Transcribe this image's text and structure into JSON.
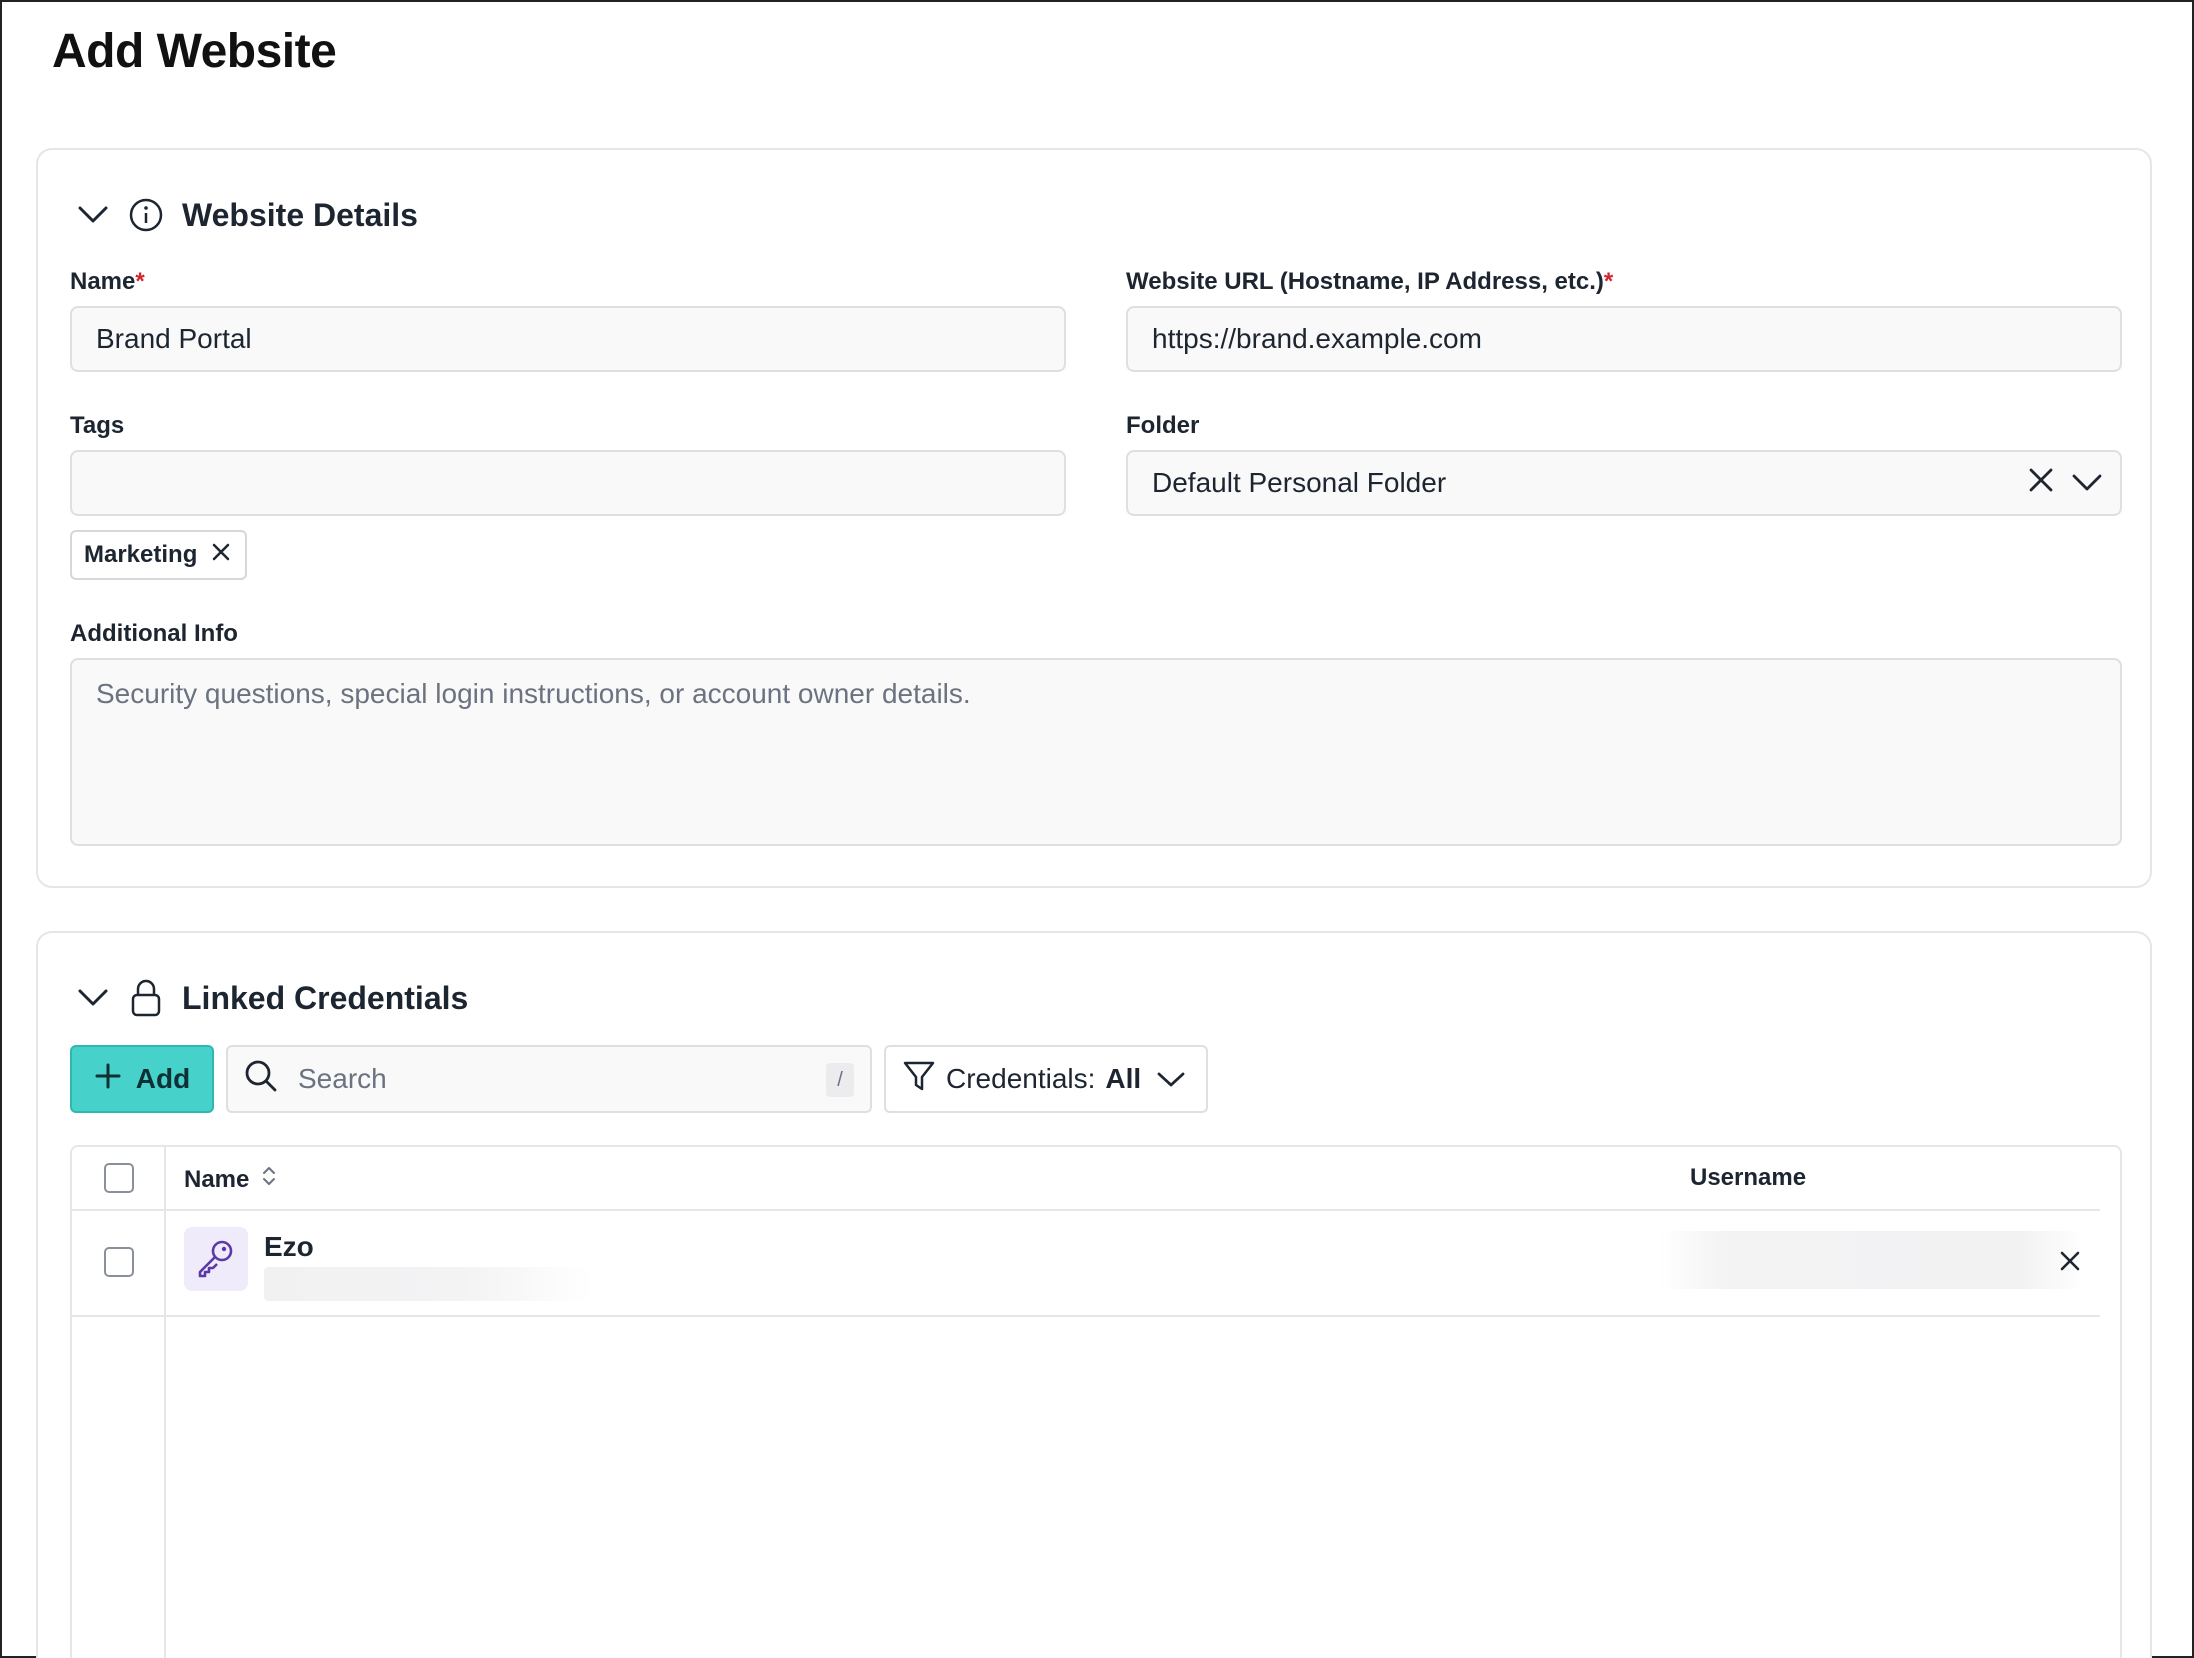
{
  "page": {
    "title": "Add Website"
  },
  "details": {
    "title": "Website Details",
    "name_label": "Name",
    "name_value": "Brand Portal",
    "url_label": "Website URL (Hostname, IP Address, etc.)",
    "url_value": "https://brand.example.com",
    "required_mark": "*",
    "tags_label": "Tags",
    "tags_value": "",
    "tags": [
      "Marketing"
    ],
    "folder_label": "Folder",
    "folder_value": "Default Personal Folder",
    "info_label": "Additional Info",
    "info_placeholder": "Security questions, special login instructions, or account owner details."
  },
  "credentials": {
    "title": "Linked Credentials",
    "add_label": "Add",
    "search_placeholder": "Search",
    "search_shortcut": "/",
    "filter_prefix": "Credentials:",
    "filter_value": "All",
    "columns": {
      "name": "Name",
      "username": "Username"
    },
    "rows": [
      {
        "name": "Ezo"
      }
    ]
  },
  "colors": {
    "accent": "#46d1cb",
    "required": "#d1242f",
    "key_icon": "#5b3aa8"
  },
  "icons": [
    "chevron-down-icon",
    "info-icon",
    "lock-icon",
    "close-icon",
    "plus-icon",
    "search-icon",
    "filter-icon",
    "sort-icon",
    "key-icon"
  ]
}
